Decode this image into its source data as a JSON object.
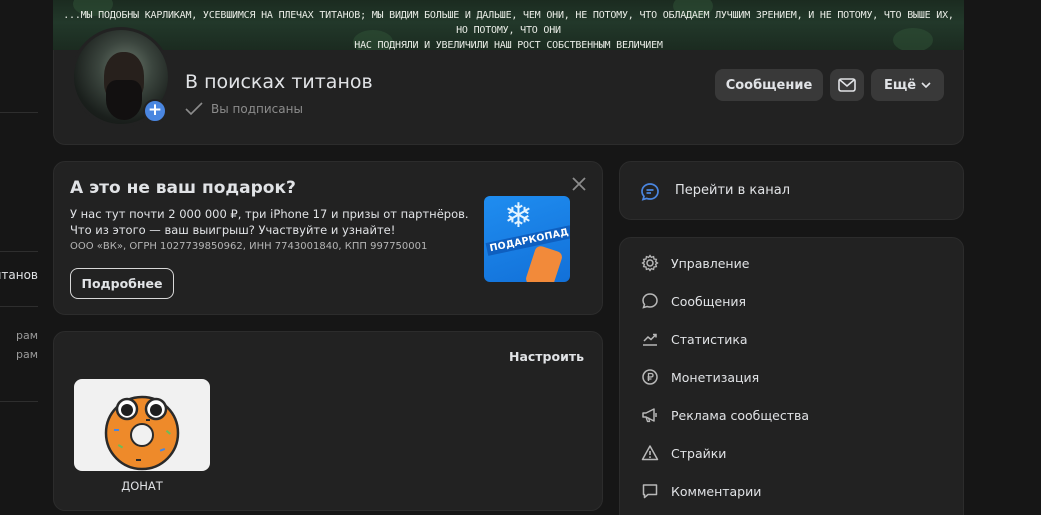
{
  "cover": {
    "quote_line1": "...МЫ ПОДОБНЫ КАРЛИКАМ, УСЕВШИМСЯ НА ПЛЕЧАХ ТИТАНОВ; МЫ ВИДИМ БОЛЬШЕ И ДАЛЬШЕ, ЧЕМ ОНИ, НЕ ПОТОМУ, ЧТО ОБЛАДАЕМ ЛУЧШИМ ЗРЕНИЕМ, И НЕ ПОТОМУ, ЧТО ВЫШЕ ИХ, НО ПОТОМУ, ЧТО ОНИ",
    "quote_line2": "НАС ПОДНЯЛИ И УВЕЛИЧИЛИ НАШ РОСТ СОБСТВЕННЫМ ВЕЛИЧИЕМ"
  },
  "left_rail": {
    "item_titans": "итанов",
    "item_a": "рам",
    "item_b": "рам"
  },
  "profile": {
    "title": "В поисках титанов",
    "subscribed": "Вы подписаны",
    "message_button": "Сообщение",
    "more_button": "Ещё"
  },
  "promo": {
    "title": "А это не ваш подарок?",
    "text": "У нас тут почти 2 000 000 ₽, три iPhone 17 и призы от партнёров. Что из этого — ваш выигрыш? Участвуйте и узнайте!",
    "legal": "ООО «ВК», ОГРН 1027739850962, ИНН 7743001840, КПП 997750001",
    "button": "Подробнее",
    "image_label": "ПОДАРКОПАД"
  },
  "donate": {
    "settings_link": "Настроить",
    "tile_caption": "ДОНАТ"
  },
  "channel": {
    "label": "Перейти в канал"
  },
  "menu": {
    "items": [
      {
        "label": "Управление",
        "icon": "gear-icon"
      },
      {
        "label": "Сообщения",
        "icon": "chat-bubble-icon"
      },
      {
        "label": "Статистика",
        "icon": "trend-chart-icon"
      },
      {
        "label": "Монетизация",
        "icon": "ruble-coin-icon"
      },
      {
        "label": "Реклама сообщества",
        "icon": "megaphone-icon"
      },
      {
        "label": "Страйки",
        "icon": "warning-icon"
      },
      {
        "label": "Комментарии",
        "icon": "comment-icon"
      }
    ]
  },
  "colors": {
    "background": "#161616",
    "card": "#222222",
    "accent_blue": "#4a86e0",
    "button": "#393939"
  }
}
